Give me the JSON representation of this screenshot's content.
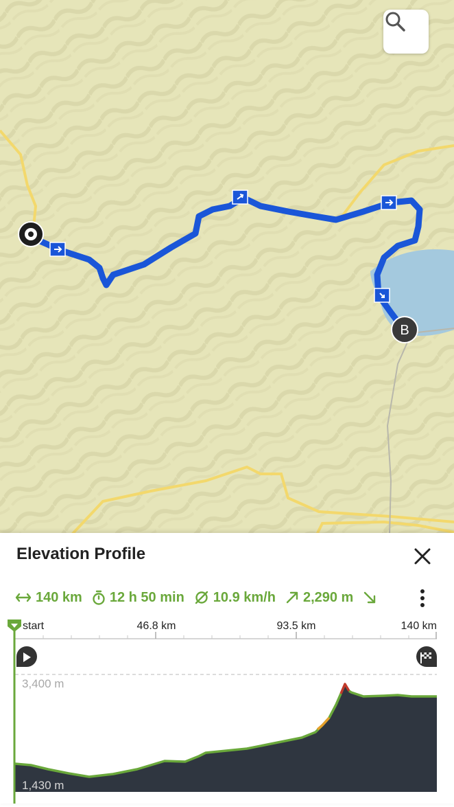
{
  "map": {
    "search_icon": "search-icon",
    "start_marker_icon": "target-icon",
    "end_marker_label": "B",
    "colors": {
      "terrain": "#e6e5b9",
      "route": "#1a56d8",
      "road": "#f3d86c",
      "lake": "#a4c9de"
    }
  },
  "panel": {
    "title": "Elevation Profile",
    "close_icon": "close-icon",
    "more_icon": "more-vertical-icon"
  },
  "stats": {
    "distance": "140 km",
    "duration": "12 h 50 min",
    "avg_speed": "10.9 km/h",
    "ascent": "2,290 m",
    "descent": ""
  },
  "profile": {
    "x_ticks": [
      "start",
      "46.8 km",
      "93.5 km",
      "140 km"
    ],
    "y_top_label": "3,400 m",
    "y_bottom_label": "1,430 m",
    "start_icon": "play-icon",
    "finish_icon": "finish-flag-icon",
    "colors": {
      "fill": "#2f3640",
      "line": "#6aa83b",
      "steep": "#c0392b",
      "cursor": "#6aa83b"
    }
  }
}
